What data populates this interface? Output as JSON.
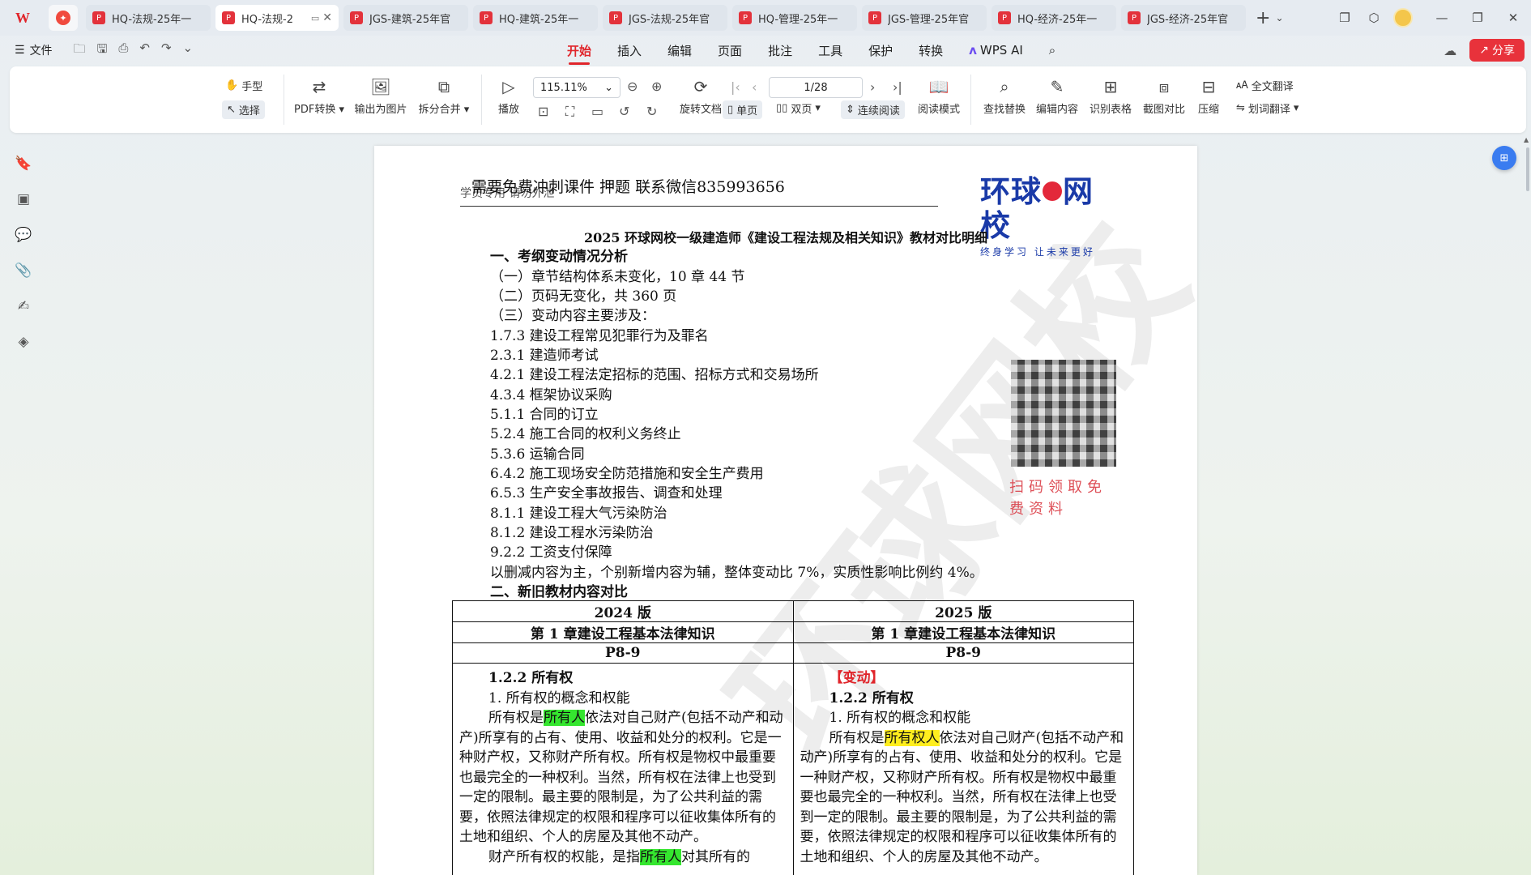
{
  "tabbar": {
    "tabs": [
      {
        "title": "HQ-法规-25年一",
        "active": false
      },
      {
        "title": "HQ-法规-2",
        "active": true
      },
      {
        "title": "JGS-建筑-25年官",
        "active": false
      },
      {
        "title": "HQ-建筑-25年一",
        "active": false
      },
      {
        "title": "JGS-法规-25年官",
        "active": false
      },
      {
        "title": "HQ-管理-25年一",
        "active": false
      },
      {
        "title": "JGS-管理-25年官",
        "active": false
      },
      {
        "title": "HQ-经济-25年一",
        "active": false
      },
      {
        "title": "JGS-经济-25年官",
        "active": false
      }
    ]
  },
  "menubar": {
    "file_label": "文件",
    "tabs": [
      "开始",
      "插入",
      "编辑",
      "页面",
      "批注",
      "工具",
      "保护",
      "转换"
    ],
    "ai_label": "WPS AI",
    "share_label": "分享"
  },
  "ribbon": {
    "hand": "手型",
    "select": "选择",
    "pdf_convert": "PDF转换",
    "export_image": "输出为图片",
    "split_merge": "拆分合并",
    "play": "播放",
    "zoom": "115.11%",
    "rotate": "旋转文档",
    "page_indicator": "1/28",
    "single_page": "单页",
    "double_page": "双页",
    "continuous": "连续阅读",
    "read_mode": "阅读模式",
    "find_replace": "查找替换",
    "edit_content": "编辑内容",
    "recognize_table": "识别表格",
    "screenshot_compare": "截图对比",
    "compress": "压缩",
    "full_translate": "全文翻译",
    "word_translate": "划词翻译"
  },
  "document": {
    "promo": "需要免费冲刺课件 押题 联系微信835993656",
    "header_sub": "学员专用 请勿外泄",
    "brand_main_left": "环球",
    "brand_main_right": "网校",
    "brand_sub": "终身学习 让未来更好",
    "watermark": "环球网校",
    "title": "2025 环球网校一级建造师《建设工程法规及相关知识》教材对比明细",
    "section1": "一、考纲变动情况分析",
    "lines": [
      "（一）章节结构体系未变化，10 章 44 节",
      "（二）页码无变化，共 360 页",
      "（三）变动内容主要涉及：",
      "1.7.3 建设工程常见犯罪行为及罪名",
      "2.3.1 建造师考试",
      "4.2.1 建设工程法定招标的范围、招标方式和交易场所",
      "4.3.4 框架协议采购",
      "5.1.1 合同的订立",
      "5.2.4 施工合同的权利义务终止",
      "5.3.6 运输合同",
      "6.4.2 施工现场安全防范措施和安全生产费用",
      "6.5.3 生产安全事故报告、调查和处理",
      "8.1.1 建设工程大气污染防治",
      "8.1.2 建设工程水污染防治",
      "9.2.2 工资支付保障",
      "以删减内容为主，个别新增内容为辅，整体变动比 7%，实质性影响比例约 4%。"
    ],
    "section2": "二、新旧教材内容对比",
    "qr_caption": "扫码领取免费资料",
    "table": {
      "col_old": "2024 版",
      "col_new": "2025 版",
      "chapter_old": "第 1 章建设工程基本法律知识",
      "chapter_new": "第 1 章建设工程基本法律知识",
      "pages_old": "P8-9",
      "pages_new": "P8-9",
      "old": {
        "heading": "1.2.2 所有权",
        "sub": "1. 所有权的概念和权能",
        "p1_pre": "所有权是",
        "p1_hl": "所有人",
        "p1_post": "依法对自己财产(包括不动产和动产)所享有的占有、使用、收益和处分的权利。它是一种财产权，又称财产所有权。所有权是物权中最重要也最完全的一种权利。当然，所有权在法律上也受到一定的限制。最主要的限制是，为了公共利益的需要，依照法律规定的权限和程序可以征收集体所有的土地和组织、个人的房屋及其他不动产。",
        "p2_pre": "财产所有权的权能，是指",
        "p2_hl": "所有人",
        "p2_post": "对其所有的"
      },
      "new": {
        "change_tag": "【变动】",
        "heading": "1.2.2 所有权",
        "sub": "1. 所有权的概念和权能",
        "p1_pre": "所有权是",
        "p1_hl": "所有权人",
        "p1_post": "依法对自己财产(包括不动产和动产)所享有的占有、使用、收益和处分的权利。它是一种财产权，又称财产所有权。所有权是物权中最重要也最完全的一种权利。当然，所有权在法律上也受到一定的限制。最主要的限制是，为了公共利益的需要，依照法律规定的权限和程序可以征收集体所有的土地和组织、个人的房屋及其他不动产。"
      }
    }
  }
}
